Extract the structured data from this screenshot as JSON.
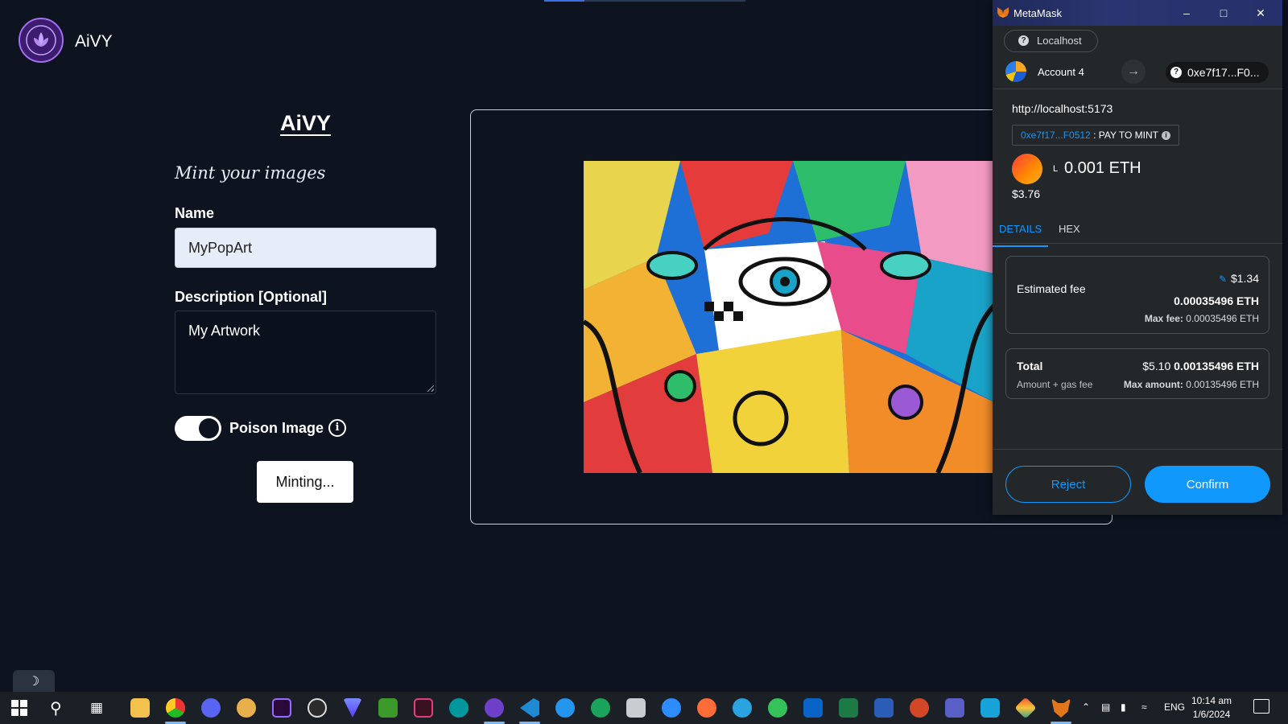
{
  "app": {
    "brand": "AiVY"
  },
  "form": {
    "title": "AiVY",
    "subtitle": "Mint your images",
    "name_label": "Name",
    "name_value": "MyPopArt",
    "description_label": "Description [Optional]",
    "description_value": "My Artwork",
    "poison_label": "Poison Image",
    "poison_enabled": true,
    "mint_button": "Minting..."
  },
  "metamask": {
    "window_title": "MetaMask",
    "network": "Localhost",
    "account": "Account 4",
    "recipient": "0xe7f17...F0...",
    "origin": "http://localhost:5173",
    "method_address": "0xe7f17...F0512",
    "method_separator": " : ",
    "method_name": "PAY TO MINT",
    "token_letter": "L",
    "amount": "0.001 ETH",
    "amount_fiat": "$3.76",
    "tabs": [
      "DETAILS",
      "HEX"
    ],
    "fee": {
      "label": "Estimated fee",
      "fiat": "$1.34",
      "eth": "0.00035496 ETH",
      "max_label": "Max fee:",
      "max_value": "0.00035496 ETH"
    },
    "total": {
      "label": "Total",
      "sub": "Amount + gas fee",
      "fiat": "$5.10",
      "eth": "0.00135496 ETH",
      "max_label": "Max amount:",
      "max_value": "0.00135496 ETH"
    },
    "reject": "Reject",
    "confirm": "Confirm"
  },
  "taskbar": {
    "language": "ENG",
    "time": "10:14 am",
    "date": "1/6/2024",
    "apps": [
      "file-explorer",
      "chrome",
      "discord",
      "paint",
      "premiere-pro",
      "obs",
      "vpn",
      "minecraft",
      "vim",
      "arduino",
      "github-desktop",
      "vscode",
      "docker",
      "edge",
      "printer",
      "zoom",
      "postman",
      "telegram",
      "sourcetree",
      "outlook",
      "excel",
      "word",
      "powerpoint",
      "teams",
      "code-editor",
      "git",
      "metamask"
    ]
  },
  "colors": {
    "page_bg": "#0d1420",
    "mm_bg": "#24272a",
    "mm_accent": "#1098fc",
    "brand_purple": "#a36ef0"
  }
}
